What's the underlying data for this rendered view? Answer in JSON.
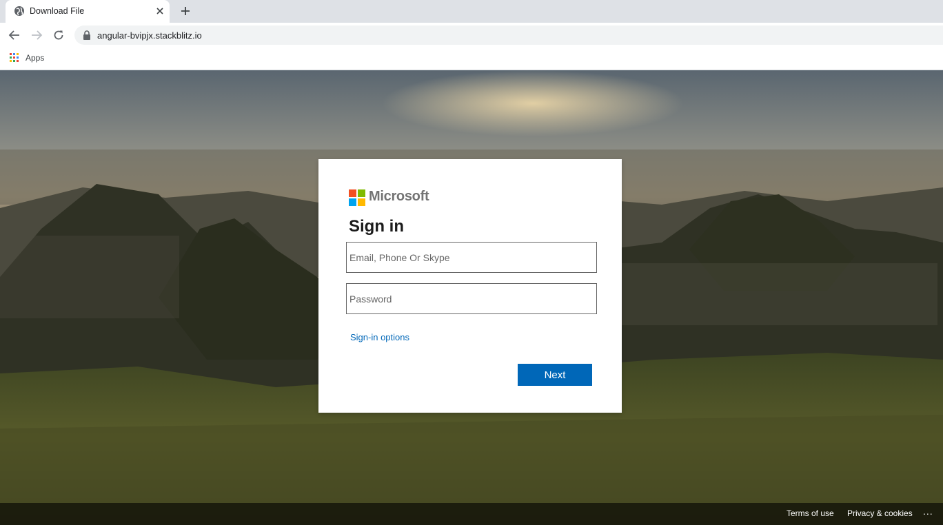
{
  "browser": {
    "tab_title": "Download File",
    "url": "angular-bvipjx.stackblitz.io",
    "bookmarks": [
      {
        "label": "Apps",
        "icon": "apps-grid-icon"
      }
    ]
  },
  "signin": {
    "brand": "Microsoft",
    "title": "Sign in",
    "email_placeholder": "Email, Phone Or Skype",
    "password_placeholder": "Password",
    "signin_options": "Sign-in options",
    "next_label": "Next",
    "logo_colors": [
      "#f25022",
      "#7fba00",
      "#00a4ef",
      "#ffb900"
    ],
    "accent": "#0067b8"
  },
  "footer": {
    "terms": "Terms of use",
    "privacy": "Privacy & cookies",
    "more": "..."
  }
}
